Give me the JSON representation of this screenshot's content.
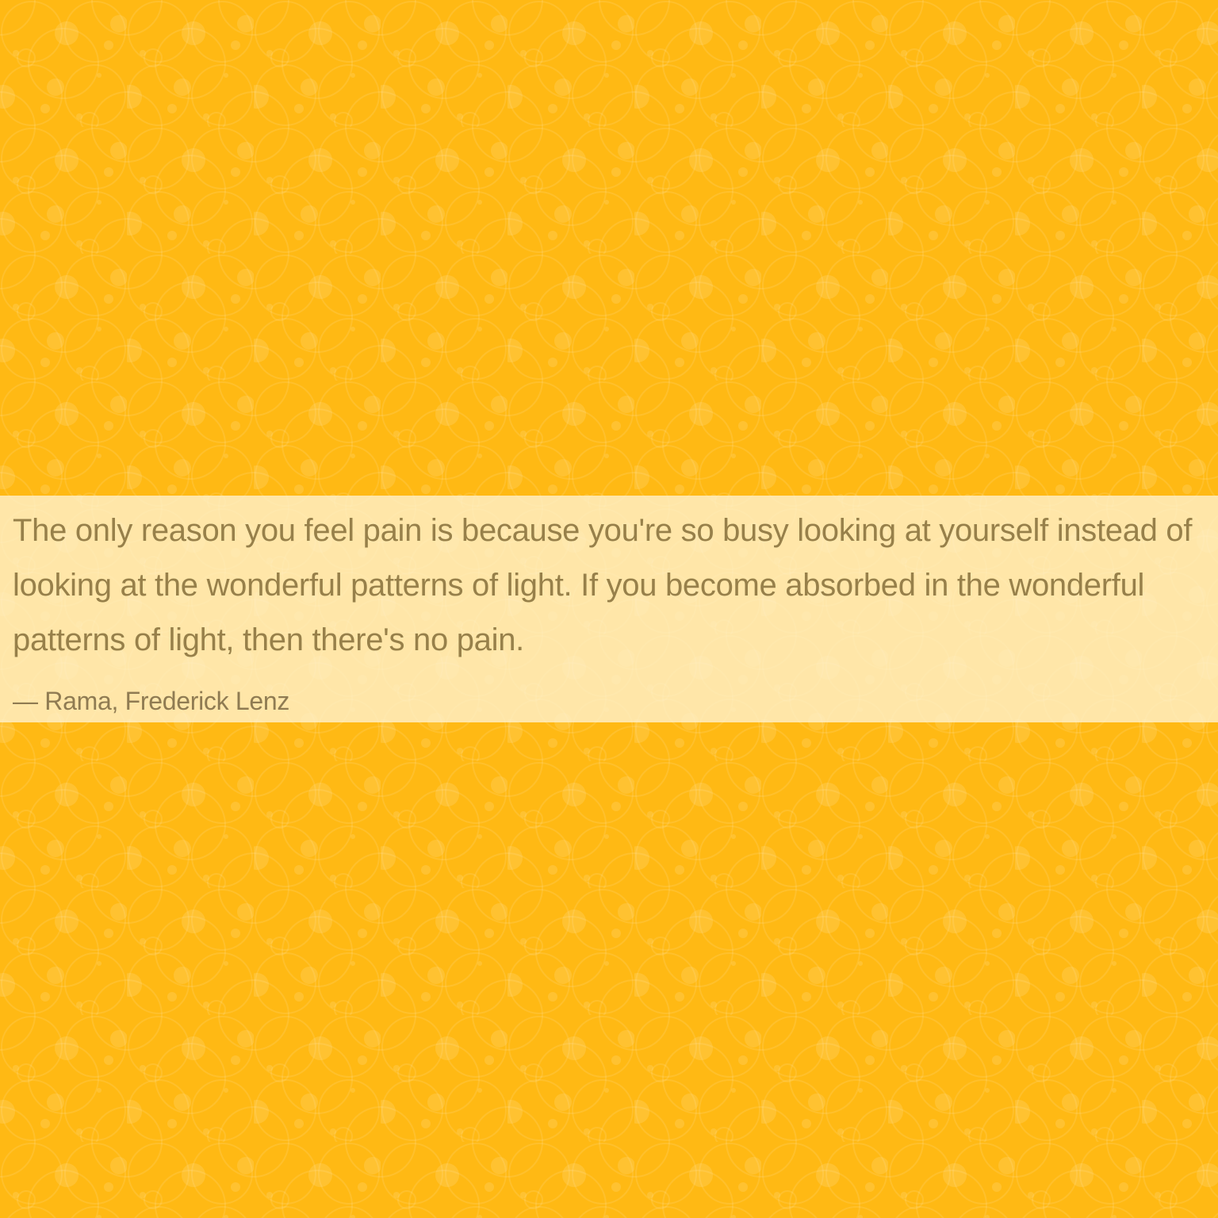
{
  "colors": {
    "background": "#FFB914",
    "band": "#FCE8B8",
    "text": "#97804A"
  },
  "quote": {
    "text": "The only reason you feel pain is because you're so busy looking at yourself instead of looking at the wonderful patterns of light. If you become absorbed in the wonderful patterns of light, then there's no pain.",
    "author": "— Rama, Frederick Lenz"
  },
  "background_pattern": "overlapping-circles"
}
